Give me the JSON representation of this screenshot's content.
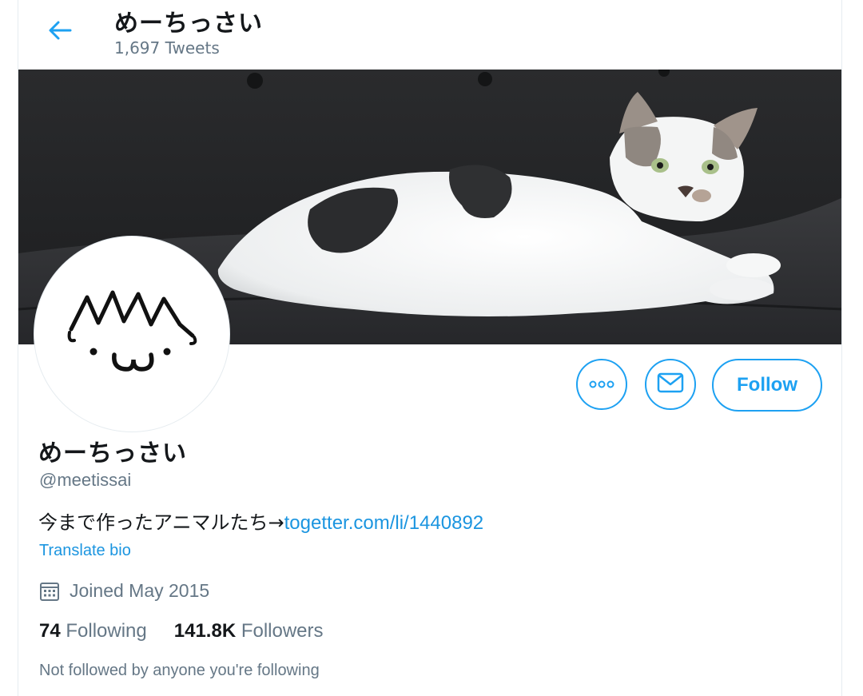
{
  "header": {
    "name": "めーちっさい",
    "tweet_count": "1,697 Tweets"
  },
  "profile": {
    "display_name": "めーちっさい",
    "handle": "@meetissai",
    "bio_text": "今まで作ったアニマルたち→",
    "bio_link": "togetter.com/li/1440892",
    "translate_label": "Translate bio",
    "joined": "Joined May 2015",
    "following_count": "74",
    "following_label": "Following",
    "followers_count": "141.8K",
    "followers_label": "Followers",
    "not_followed_text": "Not followed by anyone you're following"
  },
  "actions": {
    "follow_label": "Follow"
  },
  "icons": {
    "back": "arrow-left-icon",
    "more": "more-horizontal-icon",
    "message": "envelope-icon",
    "calendar": "calendar-icon"
  },
  "colors": {
    "accent": "#1da1f2",
    "link": "#1b95e0",
    "secondary_text": "#657786"
  }
}
